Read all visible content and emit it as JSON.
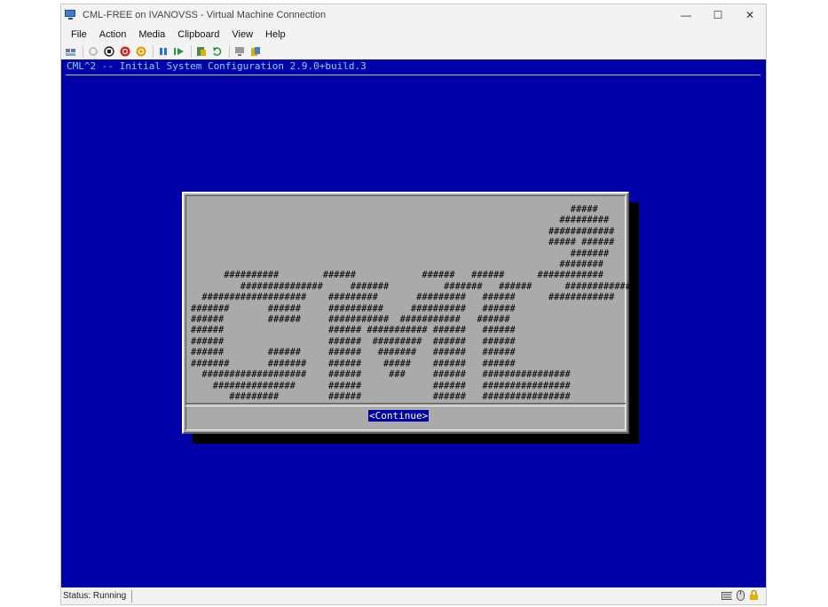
{
  "window": {
    "title": "CML-FREE on IVANOVSS - Virtual Machine Connection",
    "controls": {
      "minimize": "—",
      "maximize": "☐",
      "close": "✕"
    }
  },
  "menu": [
    "File",
    "Action",
    "Media",
    "Clipboard",
    "View",
    "Help"
  ],
  "toolbar": [
    "ctrl-alt-del-icon",
    "start-icon",
    "turn-off-icon",
    "shut-down-icon",
    "save-icon",
    "pause-icon",
    "resume-icon",
    "checkpoint-icon",
    "revert-icon",
    "enhanced-session-icon",
    "share-icon"
  ],
  "console": {
    "title": "CML^2 -- Initial System Configuration 2.9.0+build.3",
    "ascii_art": "                                                                     #####\n                                                                   #########\n                                                                 ############\n                                                                 ##### ######\n                                                                     #######\n                                                                   ########\n      ##########        ######            ######   ######      ############\n         ###############     #######          #######   ######      ############\n  ###################    #########       #########   ######      ############\n#######       ######     ##########     ##########   ######\n######        ######     ###########  ###########   ######\n######                   ###### ########### ######   ######\n######                   ######  #########  ######   ######\n######        ######     ######   #######   ######   ######\n#######       #######    ######    #####    ######   ######\n  ###################    ######     ###     ######   ################\n    ###############      ######             ######   ################\n       #########         ######             ######   ################",
    "continue_label": "<Continue>"
  },
  "status": {
    "text": "Status: Running",
    "icons": [
      "keyboard-icon",
      "mouse-icon",
      "lock-icon"
    ]
  }
}
